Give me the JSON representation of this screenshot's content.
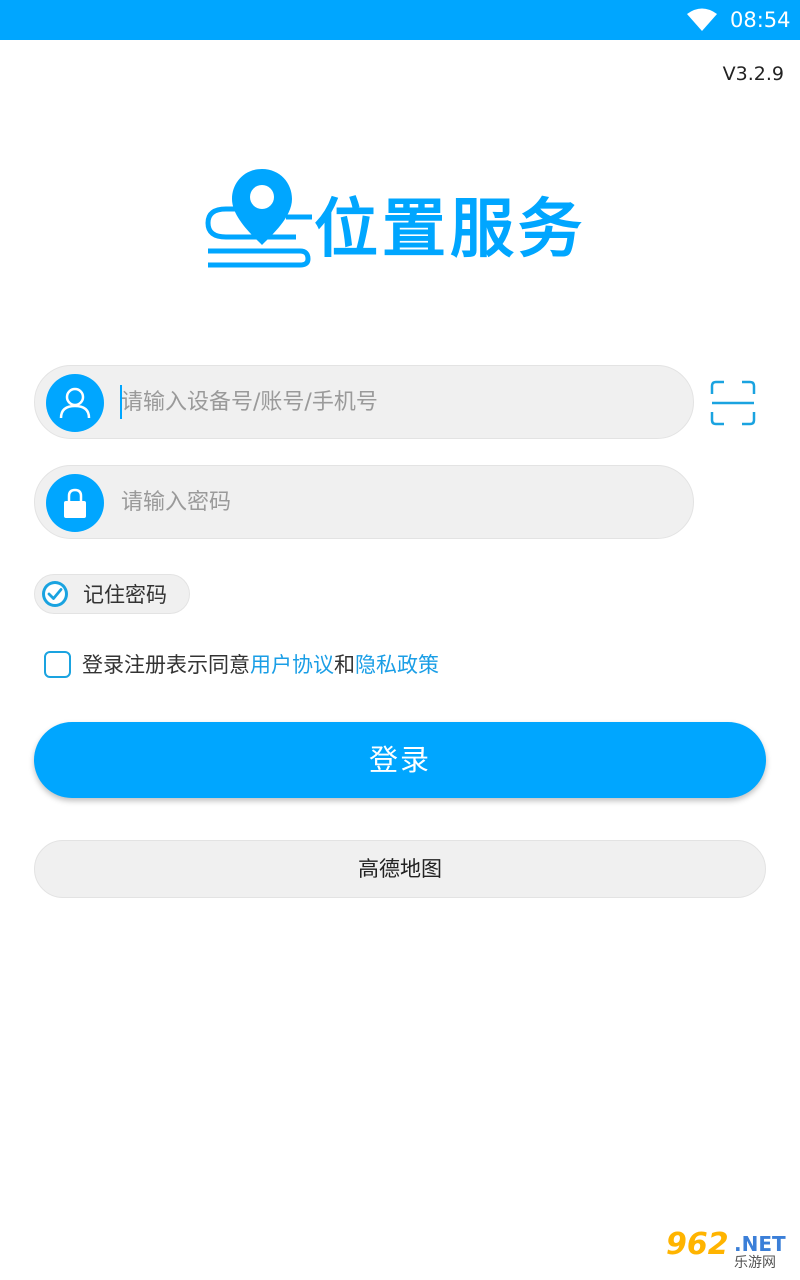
{
  "status_bar": {
    "time": "08:54",
    "wifi_icon": "wifi-icon"
  },
  "app": {
    "version": "V3.2.9",
    "logo_text": "位置服务",
    "logo_icon": "location-pin-icon",
    "brand_color": "#00a6ff"
  },
  "login_form": {
    "account_placeholder": "请输入设备号/账号/手机号",
    "account_value": "",
    "password_placeholder": "请输入密码",
    "password_value": "",
    "account_icon": "user-icon",
    "password_icon": "lock-icon",
    "scan_icon": "scan-icon",
    "remember_label": "记住密码",
    "remember_checked": true,
    "agreement_prefix": "登录注册表示同意",
    "agreement_user_link": "用户协议",
    "agreement_and": "和",
    "agreement_privacy_link": "隐私政策",
    "agreement_checked": false,
    "login_label": "登录",
    "map_label": "高德地图"
  },
  "watermark": {
    "number": "962",
    "suffix": ".NET",
    "subtitle": "乐游网"
  }
}
